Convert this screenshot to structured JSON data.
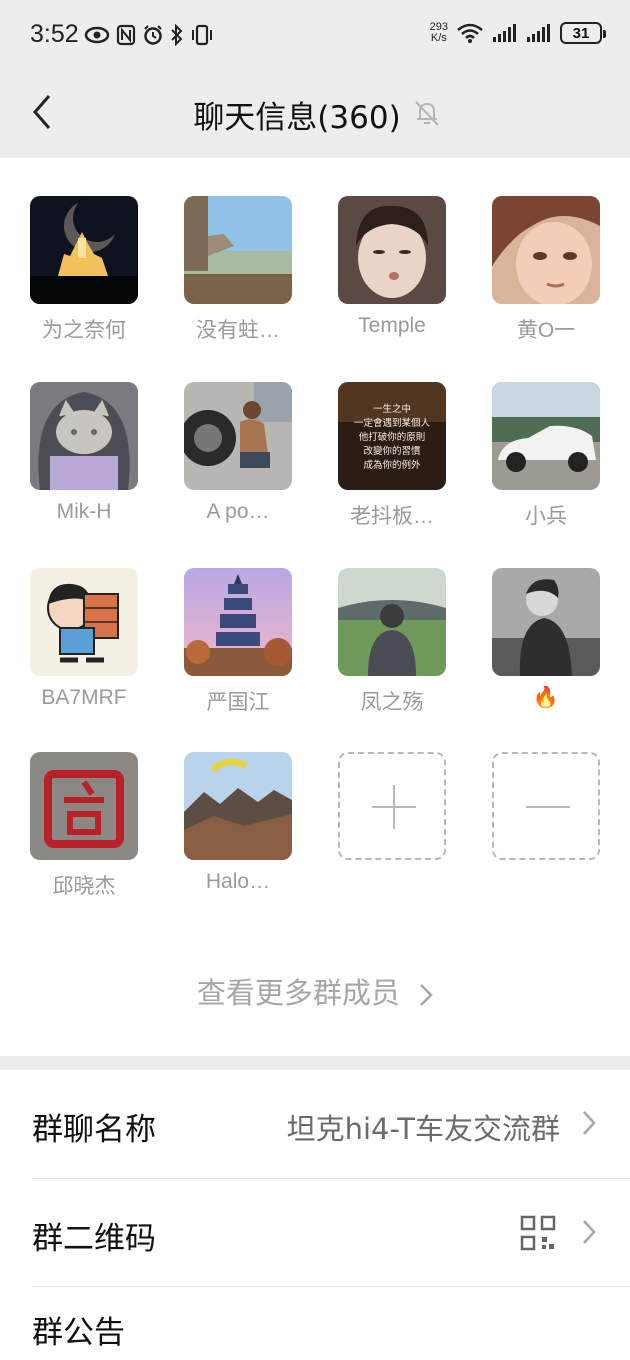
{
  "status_bar": {
    "time": "3:52",
    "net_speed_value": "293",
    "net_speed_unit": "K/s",
    "battery": "31"
  },
  "header": {
    "title": "聊天信息(360)"
  },
  "members": [
    {
      "name": "为之奈何"
    },
    {
      "name": "没有蛀…"
    },
    {
      "name": "Temple"
    },
    {
      "name": "黄O一"
    },
    {
      "name": "Mik-H"
    },
    {
      "name": "A po…"
    },
    {
      "name": "老抖板…"
    },
    {
      "name": "小兵"
    },
    {
      "name": "BA7MRF"
    },
    {
      "name": "严国江"
    },
    {
      "name": "凤之殇"
    },
    {
      "name": "🔥"
    },
    {
      "name": "邱晓杰"
    },
    {
      "name": "Halo…"
    }
  ],
  "avatar_quote_text": "一生之中 一定會遇到某個人 他打破你的原則 改變你的習慣 成為你的例外",
  "more_members": "查看更多群成员",
  "settings": {
    "group_name_label": "群聊名称",
    "group_name_value": "坦克hi4-T车友交流群",
    "qr_label": "群二维码",
    "announcement_label": "群公告"
  },
  "colors": {
    "background": "#ededed",
    "muted_text": "#9a9a9a"
  }
}
